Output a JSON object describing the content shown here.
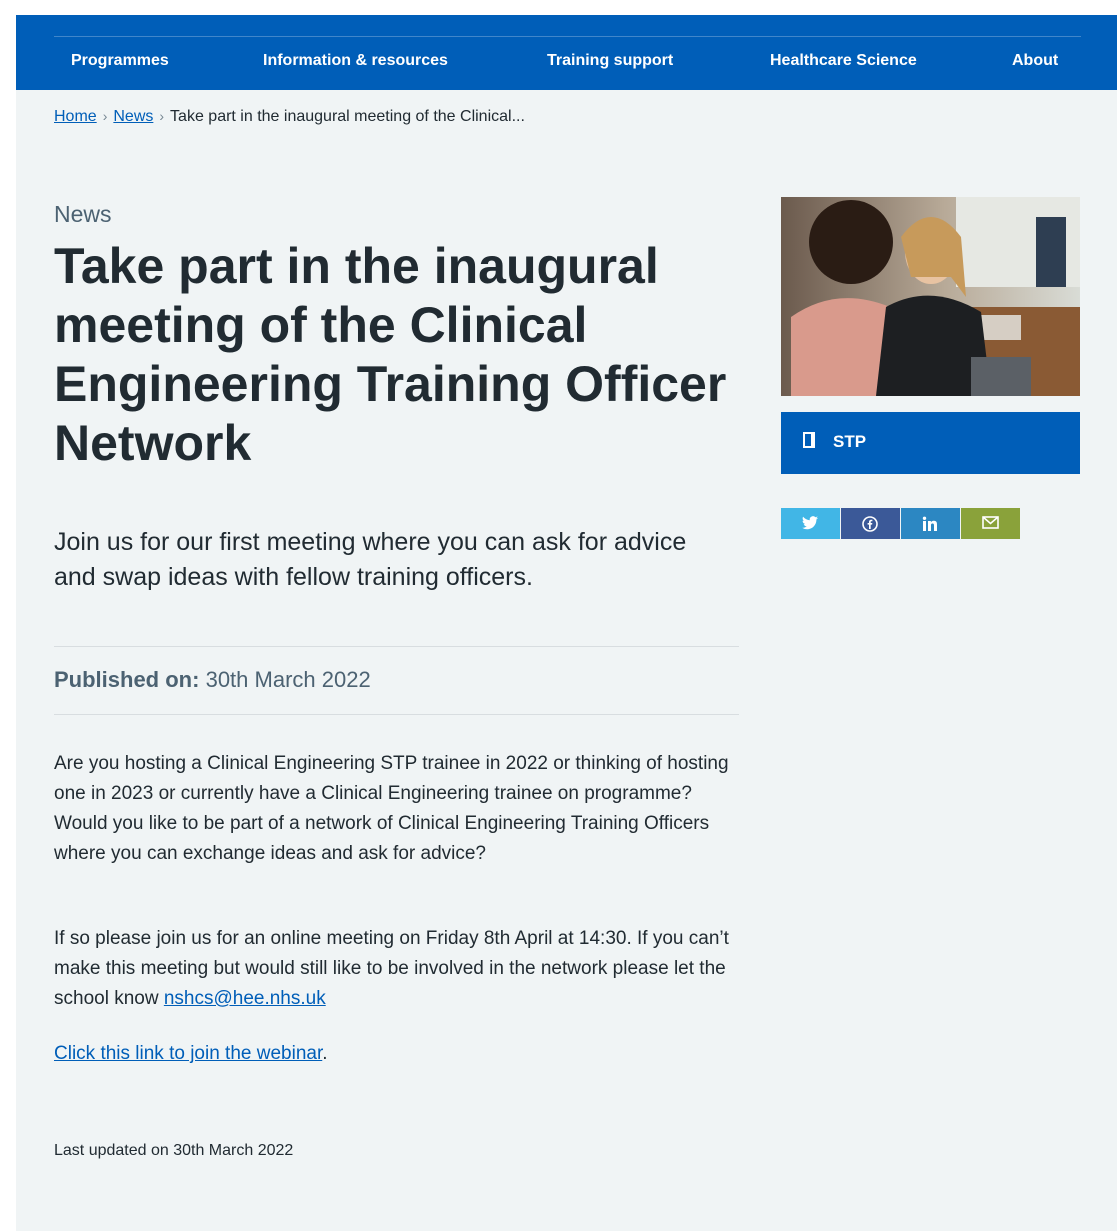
{
  "nav": {
    "items": [
      "Programmes",
      "Information & resources",
      "Training support",
      "Healthcare Science",
      "About"
    ]
  },
  "breadcrumb": {
    "home": "Home",
    "news": "News",
    "current": "Take part in the inaugural meeting of the Clinical..."
  },
  "article": {
    "kicker": "News",
    "title": "Take part in the inaugural meeting of the Clinical Engineering Training Officer Network",
    "lede": "Join us for our first meeting where you can ask for advice and swap ideas with fellow training officers.",
    "published_label": "Published on:",
    "published_date": "30th March 2022",
    "para1": "Are you hosting a Clinical Engineering STP trainee in 2022 or thinking of hosting one in 2023 or currently have a Clinical Engineering trainee on programme? Would you like to be part of a network of Clinical Engineering Training Officers where you can exchange ideas and ask for advice?",
    "para2_text": "If so please join us for an online meeting on Friday 8th April at 14:30. If you can’t make this meeting but would still like to be involved in the network please let the school know ",
    "para2_email": "nshcs@hee.nhs.uk",
    "webinar_link": "Click this link to join the webinar",
    "webinar_suffix": ".",
    "last_updated": "Last updated on 30th March 2022"
  },
  "sidebar": {
    "tag_label": "STP",
    "tag_icon": "bookmark-icon",
    "share": [
      {
        "icon": "twitter-icon",
        "color": "#41b6e6"
      },
      {
        "icon": "facebook-icon",
        "color": "#3b5998"
      },
      {
        "icon": "linkedin-icon",
        "color": "#2c87c2"
      },
      {
        "icon": "email-icon",
        "color": "#8aa23a"
      }
    ]
  },
  "colors": {
    "nav_bg": "#005eb8",
    "page_bg": "#f0f4f5",
    "link": "#005eb8"
  }
}
